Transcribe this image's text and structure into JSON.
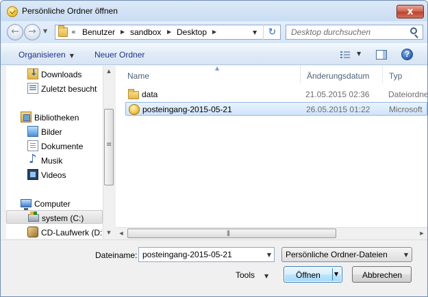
{
  "window": {
    "title": "Persönliche Ordner öffnen",
    "close_glyph": "x"
  },
  "address_bar": {
    "overflow_glyph": "«",
    "breadcrumbs": [
      "Benutzer",
      "sandbox",
      "Desktop"
    ],
    "refresh_glyph": "↻"
  },
  "search": {
    "placeholder": "Desktop durchsuchen"
  },
  "toolbar": {
    "organize_label": "Organisieren",
    "new_folder_label": "Neuer Ordner",
    "help_glyph": "?"
  },
  "nav_pane": {
    "items": [
      {
        "label": "Downloads",
        "icon": "downloads-icon"
      },
      {
        "label": "Zuletzt besucht",
        "icon": "recent-places-icon"
      },
      {
        "label": "Bibliotheken",
        "icon": "libraries-icon"
      },
      {
        "label": "Bilder",
        "icon": "pictures-icon"
      },
      {
        "label": "Dokumente",
        "icon": "documents-icon"
      },
      {
        "label": "Musik",
        "icon": "music-icon"
      },
      {
        "label": "Videos",
        "icon": "videos-icon"
      },
      {
        "label": "Computer",
        "icon": "computer-icon"
      },
      {
        "label": "system (C:)",
        "icon": "hard-drive-icon",
        "selected": true
      },
      {
        "label": "CD-Laufwerk (D:)",
        "icon": "cd-drive-icon"
      }
    ]
  },
  "file_list": {
    "columns": [
      "Name",
      "Änderungsdatum",
      "Typ"
    ],
    "rows": [
      {
        "name": "data",
        "date": "21.05.2015 02:36",
        "type": "Dateiordner",
        "icon": "folder-icon"
      },
      {
        "name": "posteingang-2015-05-21",
        "date": "26.05.2015 01:22",
        "type": "Microsoft",
        "icon": "pst-file-icon",
        "selected": true
      }
    ]
  },
  "bottom": {
    "filename_label": "Dateiname:",
    "filename_value": "posteingang-2015-05-21",
    "filetype_value": "Persönliche Ordner-Dateien",
    "tools_label": "Tools",
    "open_label": "Öffnen",
    "cancel_label": "Abbrechen"
  }
}
